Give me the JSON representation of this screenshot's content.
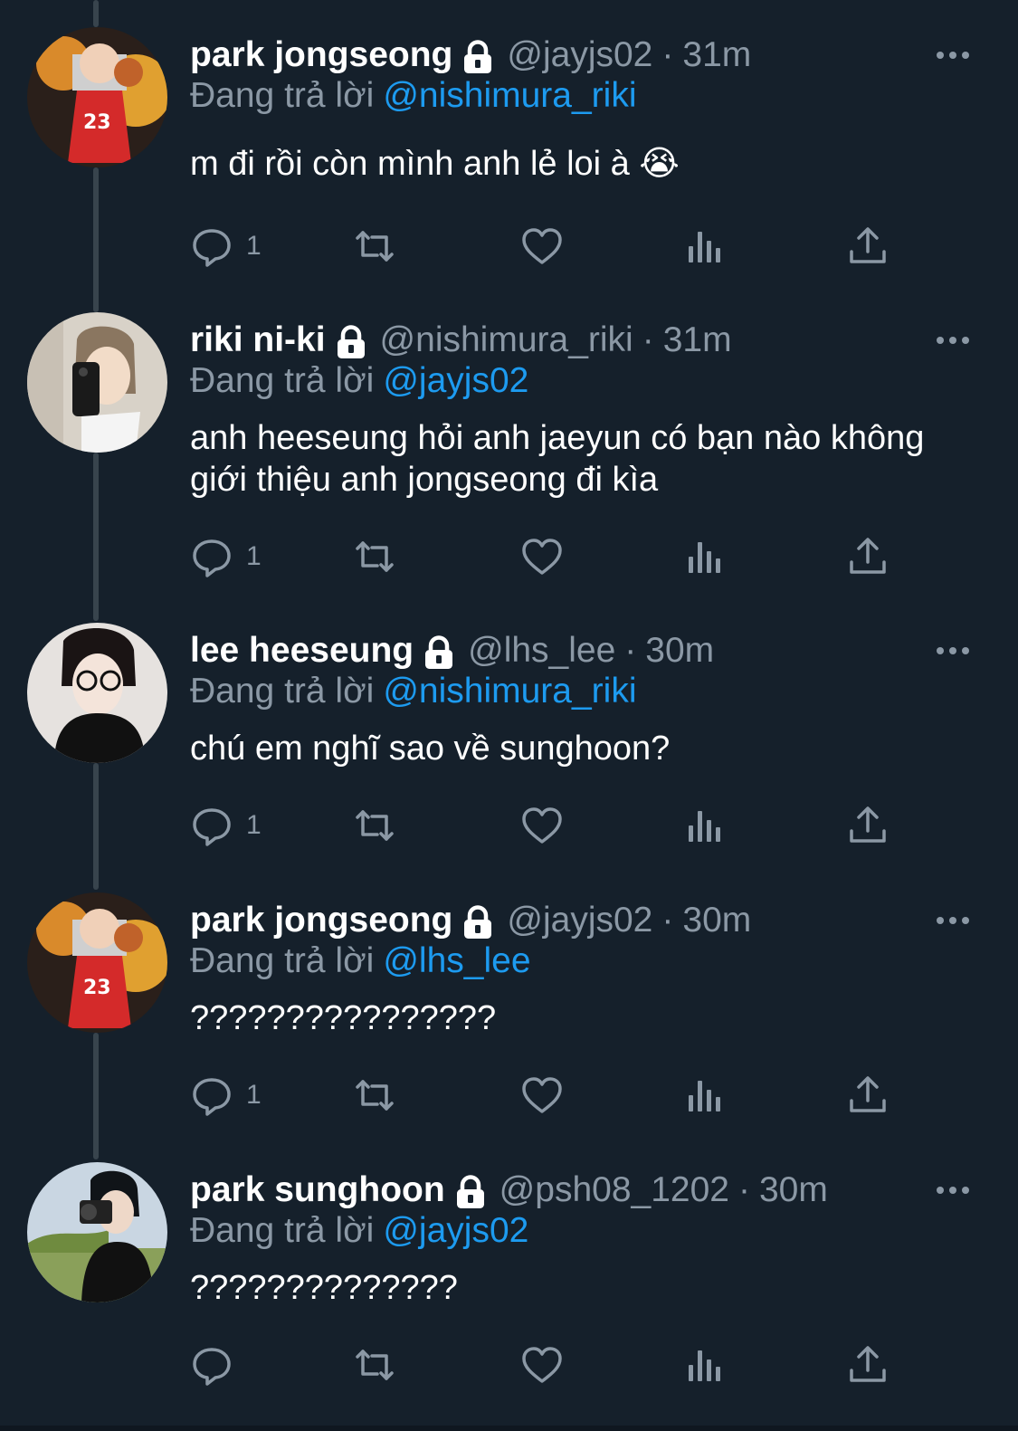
{
  "tweets": [
    {
      "name": "park jongseong",
      "handle": "@jayjs02",
      "time": "31m",
      "replying_label": "Đang trả lời",
      "replying_to": "@nishimura_riki",
      "text": "m đi rồi còn mình anh lẻ loi à 😭",
      "reply_count": "1"
    },
    {
      "name": "riki ni-ki",
      "handle": "@nishimura_riki",
      "time": "31m",
      "replying_label": "Đang trả lời",
      "replying_to": "@jayjs02",
      "text": "anh heeseung hỏi anh jaeyun có bạn nào không giới thiệu anh jongseong đi kìa",
      "reply_count": "1"
    },
    {
      "name": "lee heeseung",
      "handle": "@lhs_lee",
      "time": "30m",
      "replying_label": "Đang trả lời",
      "replying_to": "@nishimura_riki",
      "text": "chú em nghĩ sao về sunghoon?",
      "reply_count": "1"
    },
    {
      "name": "park jongseong",
      "handle": "@jayjs02",
      "time": "30m",
      "replying_label": "Đang trả lời",
      "replying_to": "@lhs_lee",
      "text": "????????????????",
      "reply_count": "1"
    },
    {
      "name": "park sunghoon",
      "handle": "@psh08_1202",
      "time": "30m",
      "replying_label": "Đang trả lời",
      "replying_to": "@jayjs02",
      "text": "??????????????",
      "reply_count": ""
    }
  ],
  "separator": "·",
  "icons": {
    "lock": "lock-icon",
    "more": "more-options-icon",
    "reply": "reply-icon",
    "retweet": "retweet-icon",
    "like": "heart-icon",
    "views": "views-chart-icon",
    "share": "share-icon"
  },
  "colors": {
    "background": "#15202b",
    "secondary_text": "#8b98a5",
    "mention": "#1d9bf0",
    "thread_line": "#38444d"
  }
}
